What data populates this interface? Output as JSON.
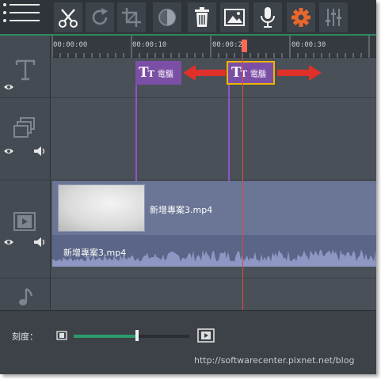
{
  "toolbar": {
    "tools": [
      {
        "name": "cut-button",
        "icon": "scissors-icon"
      },
      {
        "name": "rotate-button",
        "icon": "rotate-icon"
      },
      {
        "name": "crop-button",
        "icon": "crop-icon"
      },
      {
        "name": "color-adjust-button",
        "icon": "contrast-icon"
      },
      {
        "name": "delete-button",
        "icon": "trash-icon"
      },
      {
        "name": "image-button",
        "icon": "image-icon"
      },
      {
        "name": "record-audio-button",
        "icon": "microphone-icon"
      },
      {
        "name": "settings-button",
        "icon": "gear-icon"
      },
      {
        "name": "equalizer-button",
        "icon": "sliders-icon"
      }
    ],
    "accent_color": "#2d8a5e",
    "gear_color": "#e8672c"
  },
  "ruler": {
    "ticks": [
      "00:00:00",
      "00:00:10",
      "00:00:20",
      "00:00:30"
    ]
  },
  "tracks": {
    "title_clip_1": {
      "glyph": "TT",
      "text": "電腦"
    },
    "title_clip_2": {
      "glyph": "TT",
      "text": "電腦"
    },
    "video_clip": {
      "name": "新增專案3.mp4"
    },
    "audio_clip": {
      "name": "新增專案3.mp4"
    }
  },
  "bottom": {
    "scale_label": "刻度：",
    "zoom_level": 0.55,
    "watermark": "http://softwarecenter.pixnet.net/blog"
  },
  "colors": {
    "title_clip": "#7c4fa6",
    "playhead": "#e0483a",
    "arrow": "#e0302a",
    "selection": "#f0b400"
  }
}
